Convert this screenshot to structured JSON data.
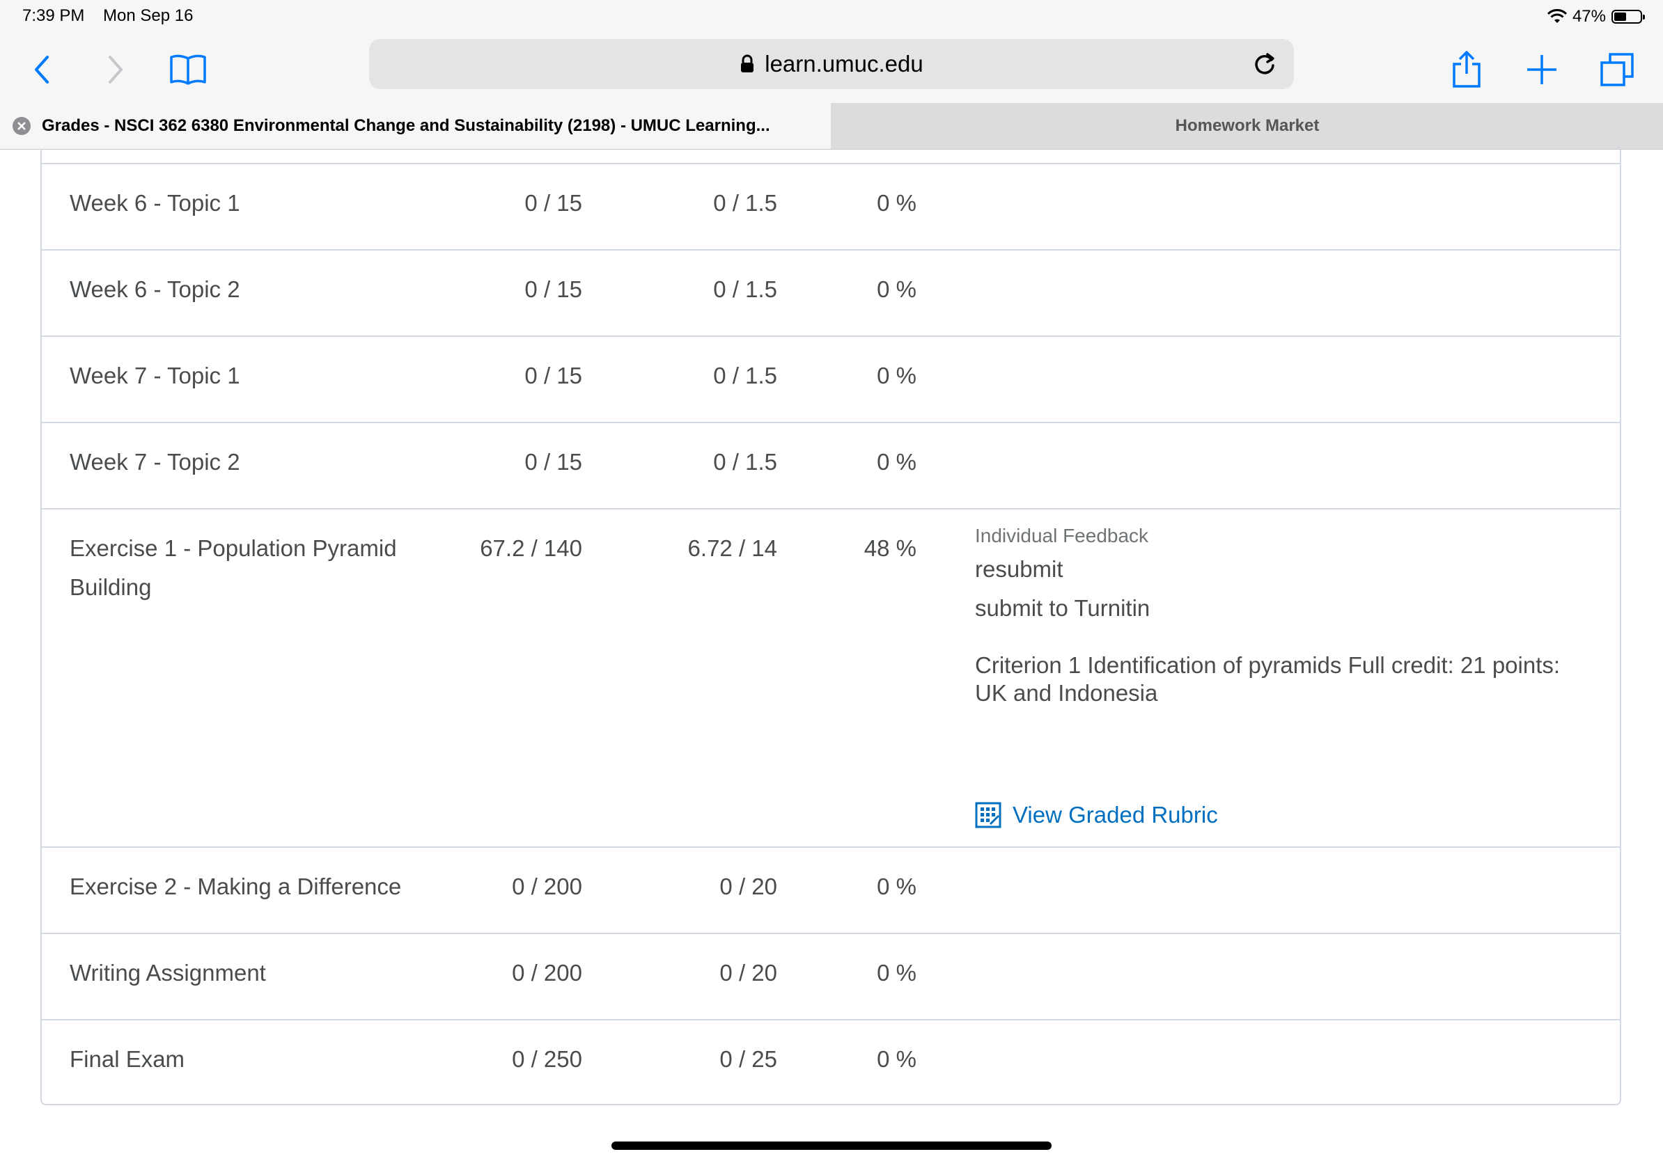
{
  "status": {
    "time": "7:39 PM",
    "date": "Mon Sep 16",
    "battery_label": "47%",
    "battery_level": 0.47
  },
  "browser": {
    "url": "learn.umuc.edu",
    "tabs": [
      {
        "title": "Grades - NSCI 362 6380 Environmental Change and Sustainability (2198) - UMUC Learning...",
        "active": true
      },
      {
        "title": "Homework Market",
        "active": false
      }
    ]
  },
  "grades": {
    "rows": [
      {
        "name": "Week 6 - Topic 1",
        "points": "0 / 15",
        "weight": "0 / 1.5",
        "percent": "0 %"
      },
      {
        "name": "Week 6 - Topic 2",
        "points": "0 / 15",
        "weight": "0 / 1.5",
        "percent": "0 %"
      },
      {
        "name": "Week 7 - Topic 1",
        "points": "0 / 15",
        "weight": "0 / 1.5",
        "percent": "0 %"
      },
      {
        "name": "Week 7 - Topic 2",
        "points": "0 / 15",
        "weight": "0 / 1.5",
        "percent": "0 %"
      },
      {
        "name": "Exercise 1 - Population Pyramid Building",
        "points": "67.2 / 140",
        "weight": "6.72 / 14",
        "percent": "48 %"
      },
      {
        "name": "Exercise 2 - Making a Difference",
        "points": "0 / 200",
        "weight": "0 / 20",
        "percent": "0 %"
      },
      {
        "name": "Writing Assignment",
        "points": "0 / 200",
        "weight": "0 / 20",
        "percent": "0 %"
      },
      {
        "name": "Final Exam",
        "points": "0 / 250",
        "weight": "0 / 25",
        "percent": "0 %"
      }
    ],
    "feedback": {
      "label": "Individual Feedback",
      "line1": "resubmit",
      "line2": "submit to Turnitin",
      "criterion": "Criterion 1 Identification of pyramids Full credit: 21 points: UK and Indonesia",
      "rubric_link": "View Graded Rubric"
    }
  },
  "colors": {
    "link": "#006fbf",
    "border": "#d3d9e3",
    "text": "#494c4e",
    "ios_blue": "#007aff"
  }
}
